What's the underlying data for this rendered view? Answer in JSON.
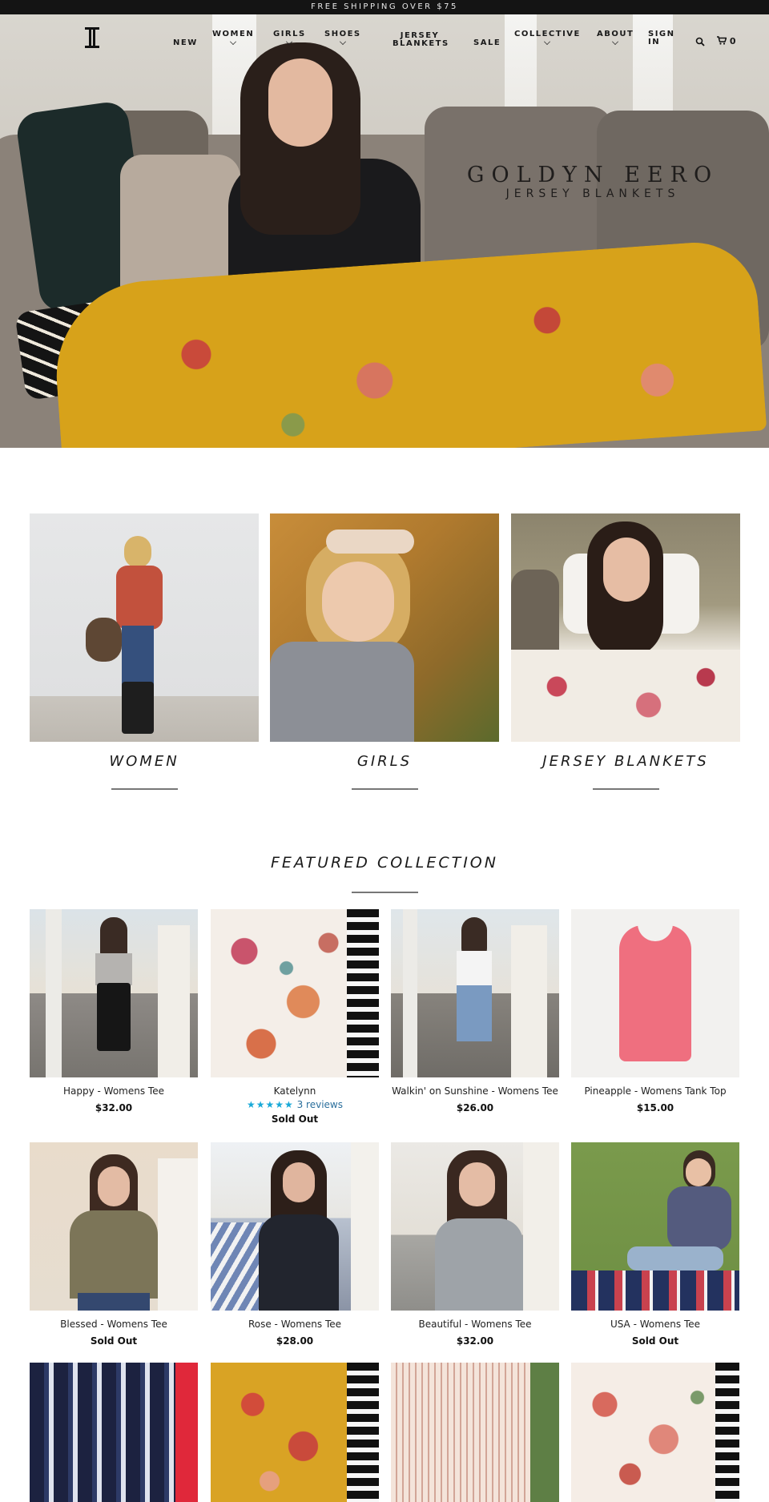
{
  "announcement": "FREE SHIPPING OVER $75",
  "nav": {
    "items": [
      {
        "label": "NEW",
        "dropdown": false
      },
      {
        "label": "WOMEN",
        "dropdown": true
      },
      {
        "label": "GIRLS",
        "dropdown": true
      },
      {
        "label": "SHOES",
        "dropdown": true
      },
      {
        "label": "JERSEY BLANKETS",
        "dropdown": false
      },
      {
        "label": "SALE",
        "dropdown": false
      },
      {
        "label": "COLLECTIVE",
        "dropdown": true
      },
      {
        "label": "ABOUT",
        "dropdown": true
      },
      {
        "label": "SIGN IN",
        "dropdown": false
      }
    ],
    "cart_count": "0",
    "search_icon": "search-icon",
    "cart_icon": "cart-icon"
  },
  "hero": {
    "brand": "GOLDYN EERO",
    "tagline": "JERSEY BLANKETS"
  },
  "collections": [
    {
      "title": "WOMEN"
    },
    {
      "title": "GIRLS"
    },
    {
      "title": "JERSEY BLANKETS"
    }
  ],
  "featured": {
    "title": "FEATURED COLLECTION",
    "products": [
      {
        "name": "Happy - Womens Tee",
        "price": "$32.00"
      },
      {
        "name": "Katelynn",
        "reviews": "3 reviews",
        "price": "Sold Out"
      },
      {
        "name": "Walkin' on Sunshine - Womens Tee",
        "price": "$26.00"
      },
      {
        "name": "Pineapple - Womens Tank Top",
        "price": "$15.00"
      },
      {
        "name": "Blessed - Womens Tee",
        "price": "Sold Out"
      },
      {
        "name": "Rose - Womens Tee",
        "price": "$28.00"
      },
      {
        "name": "Beautiful - Womens Tee",
        "price": "$32.00"
      },
      {
        "name": "USA - Womens Tee",
        "price": "Sold Out"
      }
    ]
  },
  "colors": {
    "announce_bg": "#141414",
    "star": "#18a9d8"
  }
}
